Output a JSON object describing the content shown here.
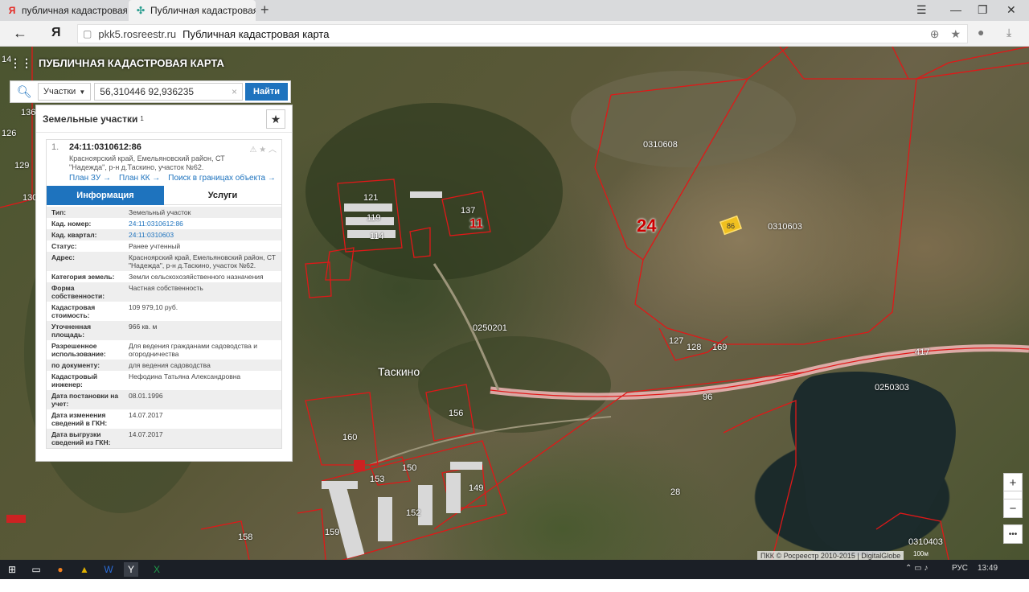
{
  "browser": {
    "tab1_title": "публичная кадастровая ка",
    "tab2_title": "Публичная кадастровая",
    "url_domain": "pkk5.rosreestr.ru",
    "url_title": "Публичная кадастровая карта",
    "yandex_letter": "Я"
  },
  "app": {
    "title": "ПУБЛИЧНАЯ КАДАСТРОВАЯ КАРТА"
  },
  "search": {
    "type": "Участки",
    "value": "56,310446 92,936235",
    "button": "Найти"
  },
  "panel": {
    "heading": "Земельные участки",
    "count": "1",
    "result": {
      "index": "1.",
      "cad_number": "24:11:0310612:86",
      "address_line1": "Красноярский край, Емельяновский район, СТ",
      "address_line2": "\"Надежда\", р-н д.Таскино, участок №62.",
      "links": [
        "План ЗУ →",
        "План КК →",
        "Поиск в границах объекта →"
      ]
    },
    "tabs": [
      "Информация",
      "Услуги"
    ],
    "attributes": [
      {
        "k": "Тип:",
        "v": "Земельный участок",
        "link": false
      },
      {
        "k": "Кад. номер:",
        "v": "24:11:0310612:86",
        "link": true
      },
      {
        "k": "Кад. квартал:",
        "v": "24:11:0310603",
        "link": true
      },
      {
        "k": "Статус:",
        "v": "Ранее учтенный",
        "link": false
      },
      {
        "k": "Адрес:",
        "v": "Красноярский край, Емельяновский район, СТ \"Надежда\", р-н д.Таскино, участок №62.",
        "link": false
      },
      {
        "k": "Категория земель:",
        "v": "Земли сельскохозяйственного назначения",
        "link": false
      },
      {
        "k": "Форма собственности:",
        "v": "Частная собственность",
        "link": false
      },
      {
        "k": "Кадастровая стоимость:",
        "v": "109 979,10 руб.",
        "link": false
      },
      {
        "k": "Уточненная площадь:",
        "v": "966 кв. м",
        "link": false
      },
      {
        "k": "Разрешенное использование:",
        "v": "Для ведения гражданами садоводства и огородничества",
        "link": false
      },
      {
        "k": "по документу:",
        "v": "для ведения садоводства",
        "link": false
      },
      {
        "k": "Кадастровый инженер:",
        "v": "Нефодина Татьяна Александровна",
        "link": false
      },
      {
        "k": "Дата постановки на учет:",
        "v": "08.01.1996",
        "link": false
      },
      {
        "k": "Дата изменения сведений в ГКН:",
        "v": "14.07.2017",
        "link": false
      },
      {
        "k": "Дата выгрузки сведений из ГКН:",
        "v": "14.07.2017",
        "link": false
      }
    ]
  },
  "map": {
    "labels": {
      "q0310608": "0310608",
      "q0310603": "0310603",
      "q0250201": "0250201",
      "q0250303": "0250303",
      "q0310403": "0310403",
      "n24": "24",
      "n11": "11",
      "n137": "137",
      "n121": "121",
      "n119": "119",
      "n114": "114",
      "n156": "156",
      "n160": "160",
      "n153": "153",
      "n150": "150",
      "n149": "149",
      "n152": "152",
      "n158": "158",
      "n159": "159",
      "n127": "127",
      "n128": "128",
      "n169": "169",
      "n417": "417",
      "n96": "96",
      "n28": "28",
      "n86": "86",
      "n14": "14",
      "n136": "136",
      "n126": "126",
      "n129": "129",
      "n130": "130",
      "town": "Таскино"
    },
    "attribution": "ПКК © Росреестр 2010-2015 | DigitalGlobe",
    "scale": "100м",
    "zoom_in": "+",
    "zoom_out": "−"
  },
  "taskbar": {
    "lang": "РУС",
    "time": "13:49"
  },
  "colors": {
    "accent": "#1e73be",
    "boundary": "#e01818"
  }
}
